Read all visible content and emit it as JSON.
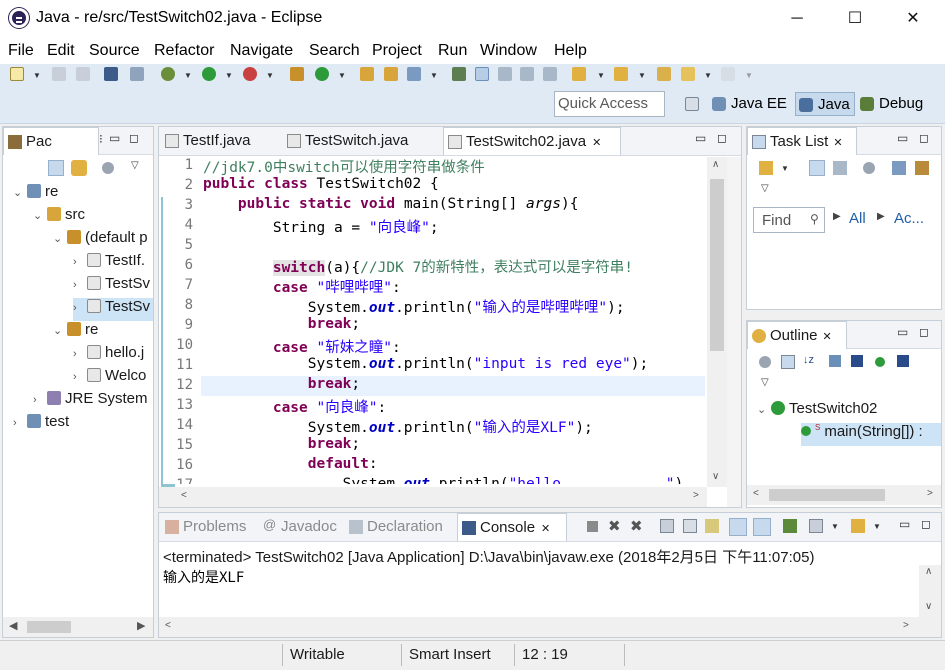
{
  "window": {
    "title": "Java - re/src/TestSwitch02.java - Eclipse",
    "minimize": "─",
    "maximize": "☐",
    "close": "✕"
  },
  "menu": [
    "File",
    "Edit",
    "Source",
    "Refactor",
    "Navigate",
    "Search",
    "Project",
    "Run",
    "Window",
    "Help"
  ],
  "toolbar": {
    "quick_access_placeholder": "Quick Access",
    "perspectives": [
      "Java EE",
      "Java",
      "Debug"
    ]
  },
  "package_explorer": {
    "tab_label": "Pac",
    "tree": [
      {
        "label": "re",
        "indent": 0,
        "chevron": "⌄",
        "icon": "project-icon"
      },
      {
        "label": "src",
        "indent": 1,
        "chevron": "⌄",
        "icon": "source-folder-icon"
      },
      {
        "label": "(default p",
        "indent": 2,
        "chevron": "⌄",
        "icon": "package-icon"
      },
      {
        "label": "TestIf.",
        "indent": 3,
        "chevron": "›",
        "icon": "java-file-icon"
      },
      {
        "label": "TestSv",
        "indent": 3,
        "chevron": "›",
        "icon": "java-file-icon"
      },
      {
        "label": "TestSv",
        "indent": 3,
        "chevron": "›",
        "icon": "java-file-icon",
        "selected": true
      },
      {
        "label": "re",
        "indent": 2,
        "chevron": "⌄",
        "icon": "package-icon"
      },
      {
        "label": "hello.j",
        "indent": 3,
        "chevron": "›",
        "icon": "java-file-icon"
      },
      {
        "label": "Welco",
        "indent": 3,
        "chevron": "›",
        "icon": "java-file-icon"
      },
      {
        "label": "JRE System",
        "indent": 1,
        "chevron": "›",
        "icon": "library-icon"
      },
      {
        "label": "test",
        "indent": 0,
        "chevron": "›",
        "icon": "project-icon"
      }
    ]
  },
  "editor": {
    "tabs": [
      "TestIf.java",
      "TestSwitch.java",
      "TestSwitch02.java"
    ],
    "active_tab": 2,
    "lines": [
      {
        "n": "1",
        "html": "<span class=\"cm\">//jdk7.0中switch可以使用字符串做条件</span>"
      },
      {
        "n": "2",
        "html": "<span class=\"kw\">public</span> <span class=\"kw\">class</span> TestSwitch02 {"
      },
      {
        "n": "3",
        "html": "    <span class=\"kw\">public</span> <span class=\"kw\">static</span> <span class=\"kw\">void</span> main(String[] <span class=\"it\">args</span>){"
      },
      {
        "n": "4",
        "html": "        String a = <span class=\"st\">\"向良峰\"</span>;"
      },
      {
        "n": "5",
        "html": ""
      },
      {
        "n": "6",
        "html": "        <span class=\"kw\" style=\"background:#e4e4e4\">switch</span>(a){<span class=\"cm\">//JDK 7的新特性，表达式可以是字符串!</span>"
      },
      {
        "n": "7",
        "html": "        <span class=\"kw\">case</span> <span class=\"st\">\"哔哩哔哩\"</span>:"
      },
      {
        "n": "8",
        "html": "            System.<span class=\"fd\">out</span>.println(<span class=\"st\">\"输入的是哔哩哔哩\"</span>);"
      },
      {
        "n": "9",
        "html": "            <span class=\"kw\">break</span>;"
      },
      {
        "n": "10",
        "html": "        <span class=\"kw\">case</span> <span class=\"st\">\"斩妹之瞳\"</span>:"
      },
      {
        "n": "11",
        "html": "            System.<span class=\"fd\">out</span>.println(<span class=\"st\">\"input is red eye\"</span>);"
      },
      {
        "n": "12",
        "html": "            <span class=\"kw\">break</span>;"
      },
      {
        "n": "13",
        "html": "        <span class=\"kw\">case</span> <span class=\"st\">\"向良峰\"</span>:"
      },
      {
        "n": "14",
        "html": "            System.<span class=\"fd\">out</span>.println(<span class=\"st\">\"输入的是XLF\"</span>);"
      },
      {
        "n": "15",
        "html": "            <span class=\"kw\">break</span>;"
      },
      {
        "n": "16",
        "html": "            <span class=\"kw\">default</span>:"
      },
      {
        "n": "17",
        "html": "                System.<span class=\"fd\">out</span>.println(<span class=\"st\">\"hello            \"</span>)"
      }
    ],
    "current_line": 12
  },
  "task_list": {
    "tab_label": "Task List",
    "find_placeholder": "Find",
    "all_label": "All",
    "activate_label": "Ac..."
  },
  "outline": {
    "tab_label": "Outline",
    "class_name": "TestSwitch02",
    "method": "main(String[]) :",
    "method_modifier": "S"
  },
  "bottom_tabs": [
    "Problems",
    "Javadoc",
    "Declaration",
    "Console"
  ],
  "console": {
    "header": "<terminated> TestSwitch02 [Java Application] D:\\Java\\bin\\javaw.exe (2018年2月5日 下午11:07:05)",
    "output": "输入的是XLF"
  },
  "status": {
    "writable": "Writable",
    "insert_mode": "Smart Insert",
    "position": "12 : 19"
  },
  "colors": {
    "keyword": "#7f0055",
    "comment": "#3f7f5f",
    "string": "#2a00ff",
    "field": "#0000c0",
    "toolbar_bg": "#dfeaf5"
  }
}
